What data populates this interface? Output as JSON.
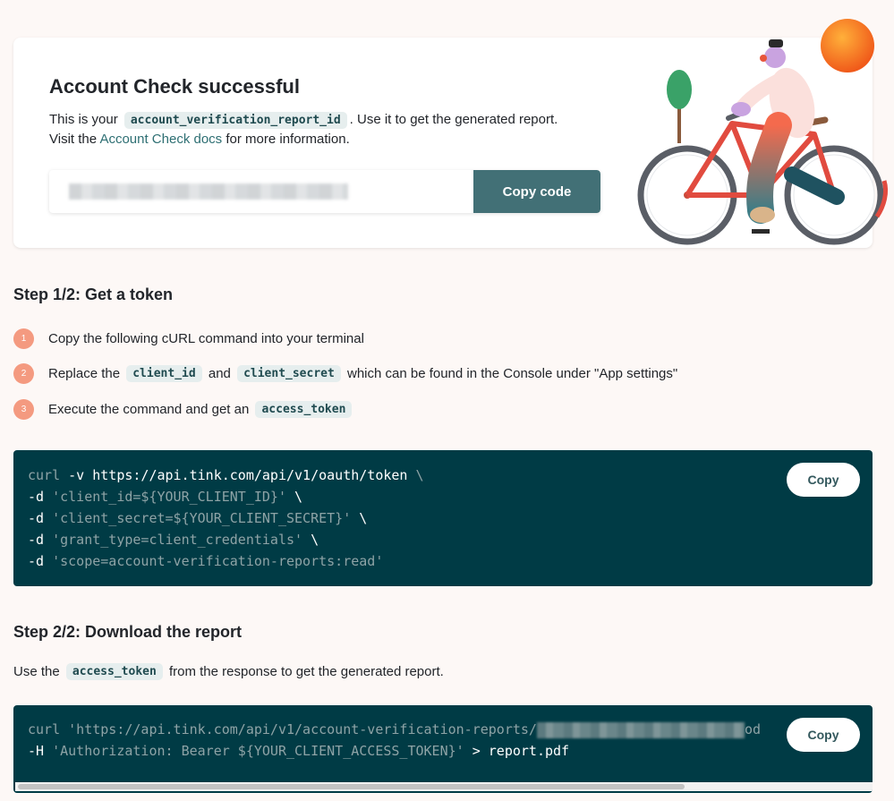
{
  "success_card": {
    "title": "Account Check successful",
    "line1_pre": "This is your",
    "report_id_code": "account_verification_report_id",
    "line1_post": ". Use it to get the generated report.",
    "line2_pre": "Visit the",
    "docs_link": "Account Check docs",
    "line2_post": "for more information.",
    "copy_code_label": "Copy code"
  },
  "step1": {
    "heading": "Step 1/2: Get a token",
    "items": [
      {
        "num": "1",
        "text": "Copy the following cURL command into your terminal"
      },
      {
        "num": "2",
        "pre": "Replace the",
        "code1": "client_id",
        "mid": "and",
        "code2": "client_secret",
        "post": "which can be found in the Console under \"App settings\""
      },
      {
        "num": "3",
        "pre": "Execute the command and get an",
        "code1": "access_token"
      }
    ],
    "code_lines": [
      {
        "cmd": "curl",
        "flag": " -v",
        "rest": " https://api.tink.com/api/v1/oauth/token",
        "tail": " \\"
      },
      {
        "cmd": "-d",
        "str": " 'client_id=${YOUR_CLIENT_ID}'",
        "tail": " \\"
      },
      {
        "cmd": "-d",
        "str": " 'client_secret=${YOUR_CLIENT_SECRET}'",
        "tail": " \\"
      },
      {
        "cmd": "-d",
        "str": " 'grant_type=client_credentials'",
        "tail": " \\"
      },
      {
        "cmd": "-d",
        "str": " 'scope=account-verification-reports:read'",
        "tail": ""
      }
    ],
    "copy_label": "Copy"
  },
  "step2": {
    "heading": "Step 2/2: Download the report",
    "desc_pre": "Use the",
    "desc_code": "access_token",
    "desc_post": "from the response to get the generated report.",
    "code_line1_cmd": "curl",
    "code_line1_str": " 'https://api.tink.com/api/v1/account-verification-reports/",
    "code_line1_tail": "od",
    "code_line2_cmd": "-H",
    "code_line2_str": " 'Authorization: Bearer ${YOUR_CLIENT_ACCESS_TOKEN}'",
    "code_line2_rest": " > report.pdf",
    "copy_label": "Copy"
  },
  "colors": {
    "accent": "#427076",
    "code_bg": "#003b45",
    "step_badge": "#f49a80",
    "chip_bg": "#e6eeee"
  }
}
